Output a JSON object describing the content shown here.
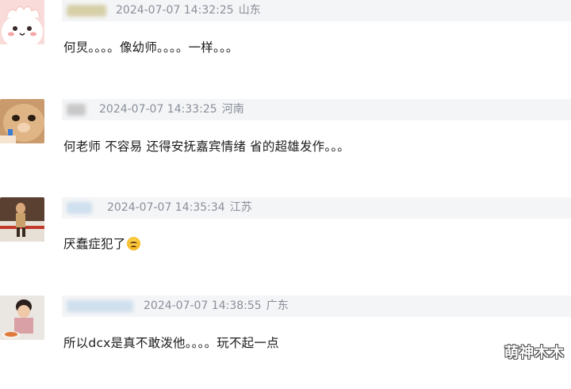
{
  "comments": [
    {
      "timestamp": "2024-07-07 14:32:25",
      "location": "山东",
      "text": "何炅。。。。像幼师。。。。一样。。。",
      "avatar_icon": "cartoon-avatar-icon"
    },
    {
      "timestamp": "2024-07-07 14:33:25",
      "location": "河南",
      "text": "何老师 不容易 还得安抚嘉宾情绪 省的超雄发作。。。",
      "avatar_icon": "cat-avatar-icon"
    },
    {
      "timestamp": "2024-07-07 14:35:34",
      "location": "江苏",
      "text": "厌蠢症犯了",
      "emoji": "sad-face-emoji",
      "avatar_icon": "photo-avatar-icon"
    },
    {
      "timestamp": "2024-07-07 14:38:55",
      "location": "广东",
      "text": "所以dcx是真不敢泼他。。。。玩不起一点",
      "avatar_icon": "child-photo-avatar-icon"
    }
  ],
  "watermark": "萌神木木",
  "colors": {
    "meta_bar": "#f4f5f7",
    "meta_text": "#8a8f99",
    "body_text": "#1c1c1c"
  }
}
